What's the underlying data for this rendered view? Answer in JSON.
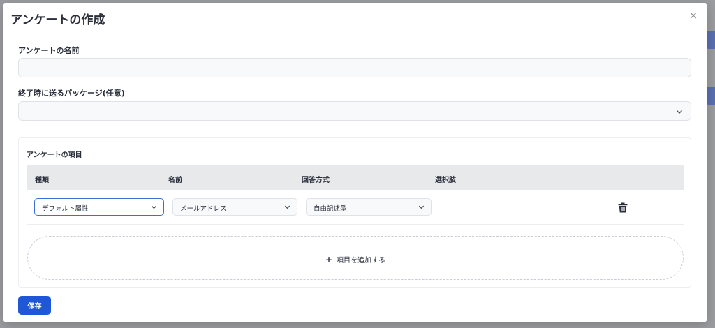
{
  "modal": {
    "title": "アンケートの作成",
    "close_label": "×"
  },
  "form": {
    "name_label": "アンケートの名前",
    "name_value": "",
    "package_label": "終了時に送るパッケージ(任意)",
    "package_value": ""
  },
  "items": {
    "title": "アンケートの項目",
    "columns": [
      "種類",
      "名前",
      "回答方式",
      "選択肢"
    ],
    "rows": [
      {
        "type": "デフォルト属性",
        "name": "メールアドレス",
        "answer_format": "自由記述型",
        "choices": ""
      }
    ],
    "add_label": "項目を追加する"
  },
  "actions": {
    "save_label": "保存"
  },
  "colors": {
    "primary": "#1f57d6",
    "focus_border": "#3b6fd6",
    "table_header_bg": "#e8e9eb"
  },
  "icons": {
    "close": "close-icon",
    "chevron": "chevron-down-icon",
    "delete": "trash-icon",
    "add": "plus-icon"
  }
}
